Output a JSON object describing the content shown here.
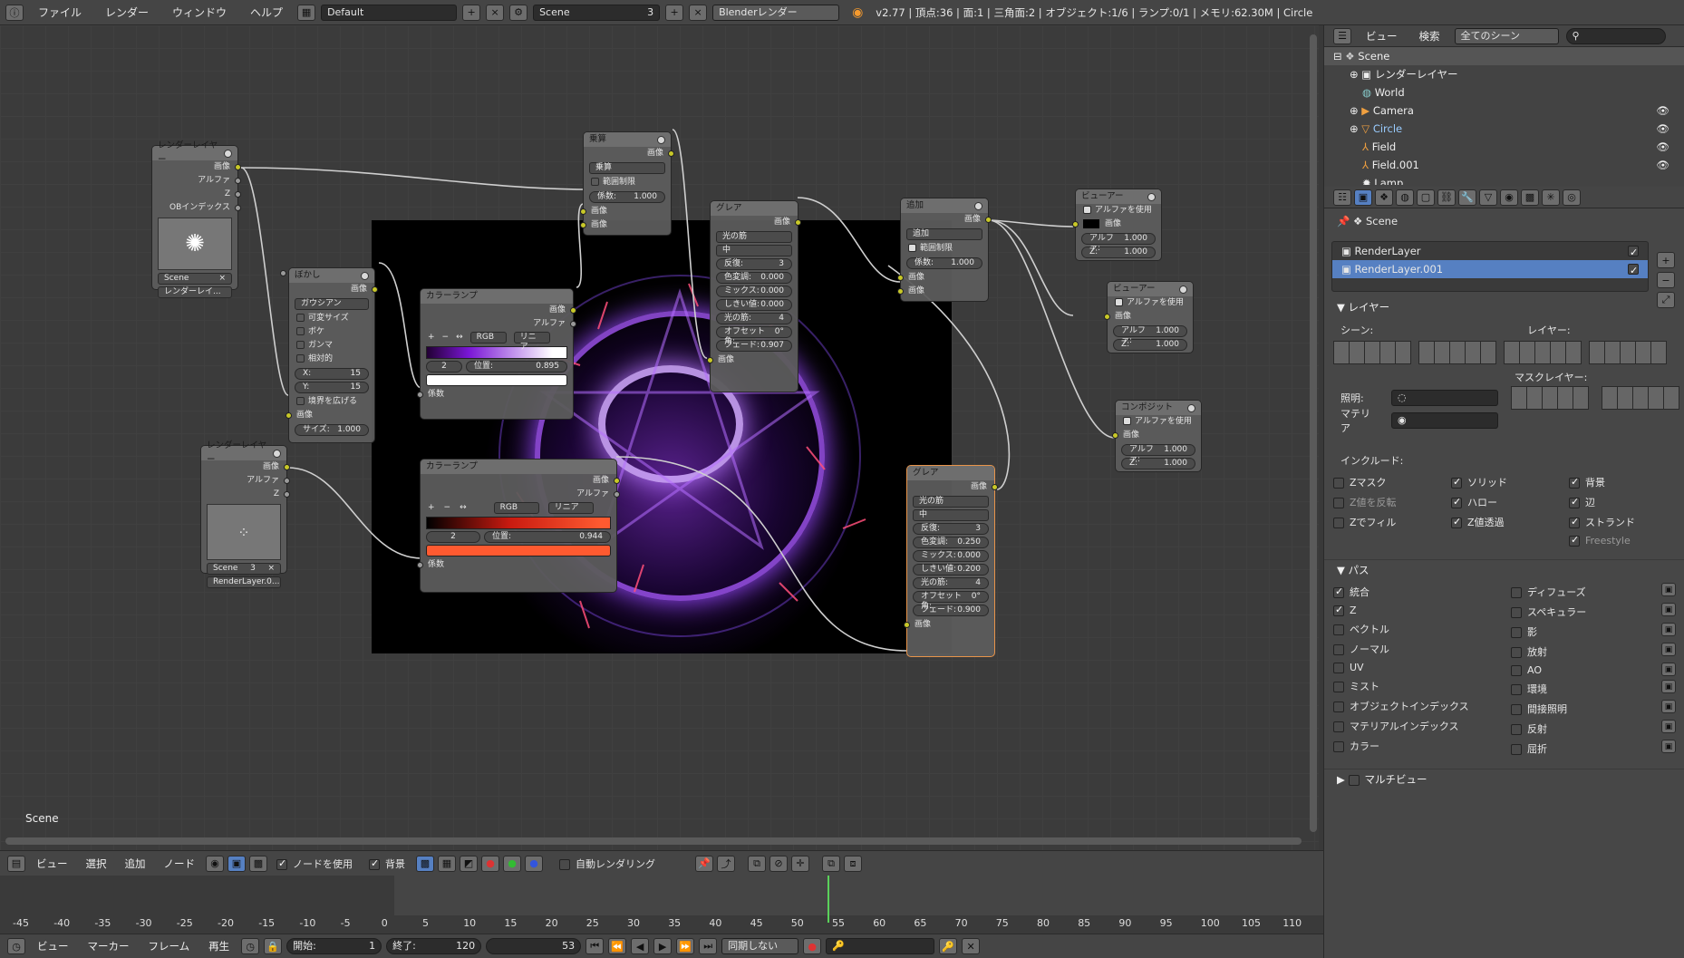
{
  "topbar": {
    "menus": [
      "ファイル",
      "レンダー",
      "ウィンドウ",
      "ヘルプ"
    ],
    "layout": "Default",
    "scene": "Scene",
    "scene_num": "3",
    "engine": "Blenderレンダー",
    "stats": "v2.77 | 頂点:36 | 面:1 | 三角面:2 | オブジェクト:1/6 | ランプ:0/1 | メモリ:62.30M | Circle"
  },
  "editor": {
    "scene_label": "Scene"
  },
  "nodes": {
    "rl1": {
      "title": "レンダーレイヤー",
      "outs": [
        "画像",
        "アルファ",
        "Z",
        "OBインデックス"
      ],
      "scene": "Scene",
      "layer": "レンダーレイ..."
    },
    "blur": {
      "title": "ぼかし",
      "out": "画像",
      "type": "ガウシアン",
      "opts": [
        "可変サイズ",
        "ボケ",
        "ガンマ",
        "相対的"
      ],
      "x_label": "X:",
      "x_val": "15",
      "y_label": "Y:",
      "y_val": "15",
      "extend": "境界を広げる",
      "in": "画像",
      "size_label": "サイズ:",
      "size_val": "1.000"
    },
    "ramp1": {
      "title": "カラーランプ",
      "outs": [
        "画像",
        "アルファ"
      ],
      "mode": "RGB",
      "interp": "リニア",
      "idx": "2",
      "pos_label": "位置:",
      "pos_val": "0.895",
      "in": "係数"
    },
    "mult": {
      "title": "乗算",
      "out": "画像",
      "mode": "乗算",
      "clamp": "範囲制限",
      "fac_label": "係数:",
      "fac_val": "1.000",
      "ins": [
        "画像",
        "画像"
      ]
    },
    "glare1": {
      "title": "グレア",
      "out": "画像",
      "type": "光の筋",
      "quality": "中",
      "fields": [
        [
          "反復:",
          "3"
        ],
        [
          "色変調:",
          "0.000"
        ],
        [
          "ミックス:",
          "0.000"
        ],
        [
          "しきい値:",
          "0.000"
        ],
        [
          "光の筋:",
          "4"
        ],
        [
          "オフセット角:",
          "0°"
        ],
        [
          "フェード:",
          "0.907"
        ]
      ],
      "in": "画像"
    },
    "add": {
      "title": "追加",
      "out": "画像",
      "mode": "追加",
      "clamp": "範囲制限",
      "fac_label": "係数:",
      "fac_val": "1.000",
      "ins": [
        "画像",
        "画像"
      ]
    },
    "viewer1": {
      "title": "ビューアー",
      "use_alpha": "アルファを使用",
      "in": "画像",
      "a_label": "アルファ:",
      "a_val": "1.000",
      "z_label": "Z:",
      "z_val": "1.000"
    },
    "viewer2": {
      "title": "ビューアー",
      "use_alpha": "アルファを使用",
      "in": "画像",
      "a_label": "アルファ:",
      "a_val": "1.000",
      "z_label": "Z:",
      "z_val": "1.000"
    },
    "comp": {
      "title": "コンポジット",
      "use_alpha": "アルファを使用",
      "in": "画像",
      "a_label": "アルファ:",
      "a_val": "1.000",
      "z_label": "Z:",
      "z_val": "1.000"
    },
    "rl2": {
      "title": "レンダーレイヤー",
      "outs": [
        "画像",
        "アルファ",
        "Z"
      ],
      "scene": "Scene",
      "scene_num": "3",
      "layer": "RenderLayer.0..."
    },
    "ramp2": {
      "title": "カラーランプ",
      "outs": [
        "画像",
        "アルファ"
      ],
      "mode": "RGB",
      "interp": "リニア",
      "idx": "2",
      "pos_label": "位置:",
      "pos_val": "0.944",
      "in": "係数"
    },
    "glare2": {
      "title": "グレア",
      "out": "画像",
      "type": "光の筋",
      "quality": "中",
      "fields": [
        [
          "反復:",
          "3"
        ],
        [
          "色変調:",
          "0.250"
        ],
        [
          "ミックス:",
          "0.000"
        ],
        [
          "しきい値:",
          "0.200"
        ],
        [
          "光の筋:",
          "4"
        ],
        [
          "オフセット角:",
          "0°"
        ],
        [
          "フェード:",
          "0.900"
        ]
      ],
      "in": "画像"
    }
  },
  "outliner": {
    "menus": [
      "ビュー",
      "検索"
    ],
    "filter": "全てのシーン",
    "items": [
      "Scene",
      "レンダーレイヤー",
      "World",
      "Camera",
      "Circle",
      "Field",
      "Field.001",
      "Lamp"
    ]
  },
  "props": {
    "context": "Scene",
    "layers": [
      "RenderLayer",
      "RenderLayer.001"
    ],
    "layer_section": "レイヤー",
    "scene_lbl": "シーン:",
    "layer_lbl": "レイヤー:",
    "mask_lbl": "マスクレイヤー:",
    "light_lbl": "照明:",
    "mat_lbl": "マテリア",
    "include_lbl": "インクルード:",
    "include": [
      [
        "Zマスク",
        false
      ],
      [
        "ソリッド",
        true
      ],
      [
        "背景",
        true
      ],
      [
        "Z値を反転",
        false
      ],
      [
        "ハロー",
        true
      ],
      [
        "辺",
        true
      ],
      [
        "Zでフィル",
        false
      ],
      [
        "Z値透過",
        true
      ],
      [
        "ストランド",
        true
      ],
      [
        "",
        false
      ],
      [
        "",
        false
      ],
      [
        "Freestyle",
        true
      ]
    ],
    "pass_section": "パス",
    "passes_left": [
      [
        "統合",
        true
      ],
      [
        "Z",
        true
      ],
      [
        "ベクトル",
        false
      ],
      [
        "ノーマル",
        false
      ],
      [
        "UV",
        false
      ],
      [
        "ミスト",
        false
      ],
      [
        "オブジェクトインデックス",
        false
      ],
      [
        "マテリアルインデックス",
        false
      ],
      [
        "カラー",
        false
      ]
    ],
    "passes_right": [
      "ディフューズ",
      "スペキュラー",
      "影",
      "放射",
      "AO",
      "環境",
      "間接照明",
      "反射",
      "屈折"
    ],
    "multiview": "マルチビュー"
  },
  "toolbar2": {
    "menus": [
      "ビュー",
      "選択",
      "追加",
      "ノード"
    ],
    "use_nodes": "ノードを使用",
    "backdrop": "背景",
    "auto_render": "自動レンダリング"
  },
  "timeline": {
    "ticks": [
      "-45",
      "-40",
      "-35",
      "-30",
      "-25",
      "-20",
      "-15",
      "-10",
      "-5",
      "0",
      "5",
      "10",
      "15",
      "20",
      "25",
      "30",
      "35",
      "40",
      "45",
      "50",
      "55",
      "60",
      "65",
      "70",
      "75",
      "80",
      "85",
      "90",
      "95",
      "100",
      "105",
      "110"
    ]
  },
  "bottombar": {
    "menus": [
      "ビュー",
      "マーカー",
      "フレーム",
      "再生"
    ],
    "start_label": "開始:",
    "start_val": "1",
    "end_label": "終了:",
    "end_val": "120",
    "frame": "53",
    "sync": "同期しない"
  }
}
